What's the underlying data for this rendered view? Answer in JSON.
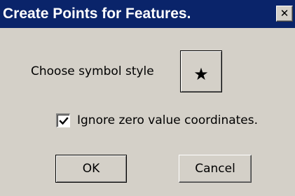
{
  "window": {
    "title": "Create Points for Features.",
    "close_glyph": "✕"
  },
  "symbol": {
    "label": "Choose symbol style",
    "glyph": "★",
    "icon": "star-icon"
  },
  "options": {
    "ignore_zero": {
      "label": "Ignore zero value coordinates.",
      "checked": true
    }
  },
  "buttons": {
    "ok_label": "OK",
    "cancel_label": "Cancel"
  },
  "colors": {
    "titlebar": "#0a246a",
    "face": "#d4d0c8",
    "title_text": "#ffffff"
  }
}
